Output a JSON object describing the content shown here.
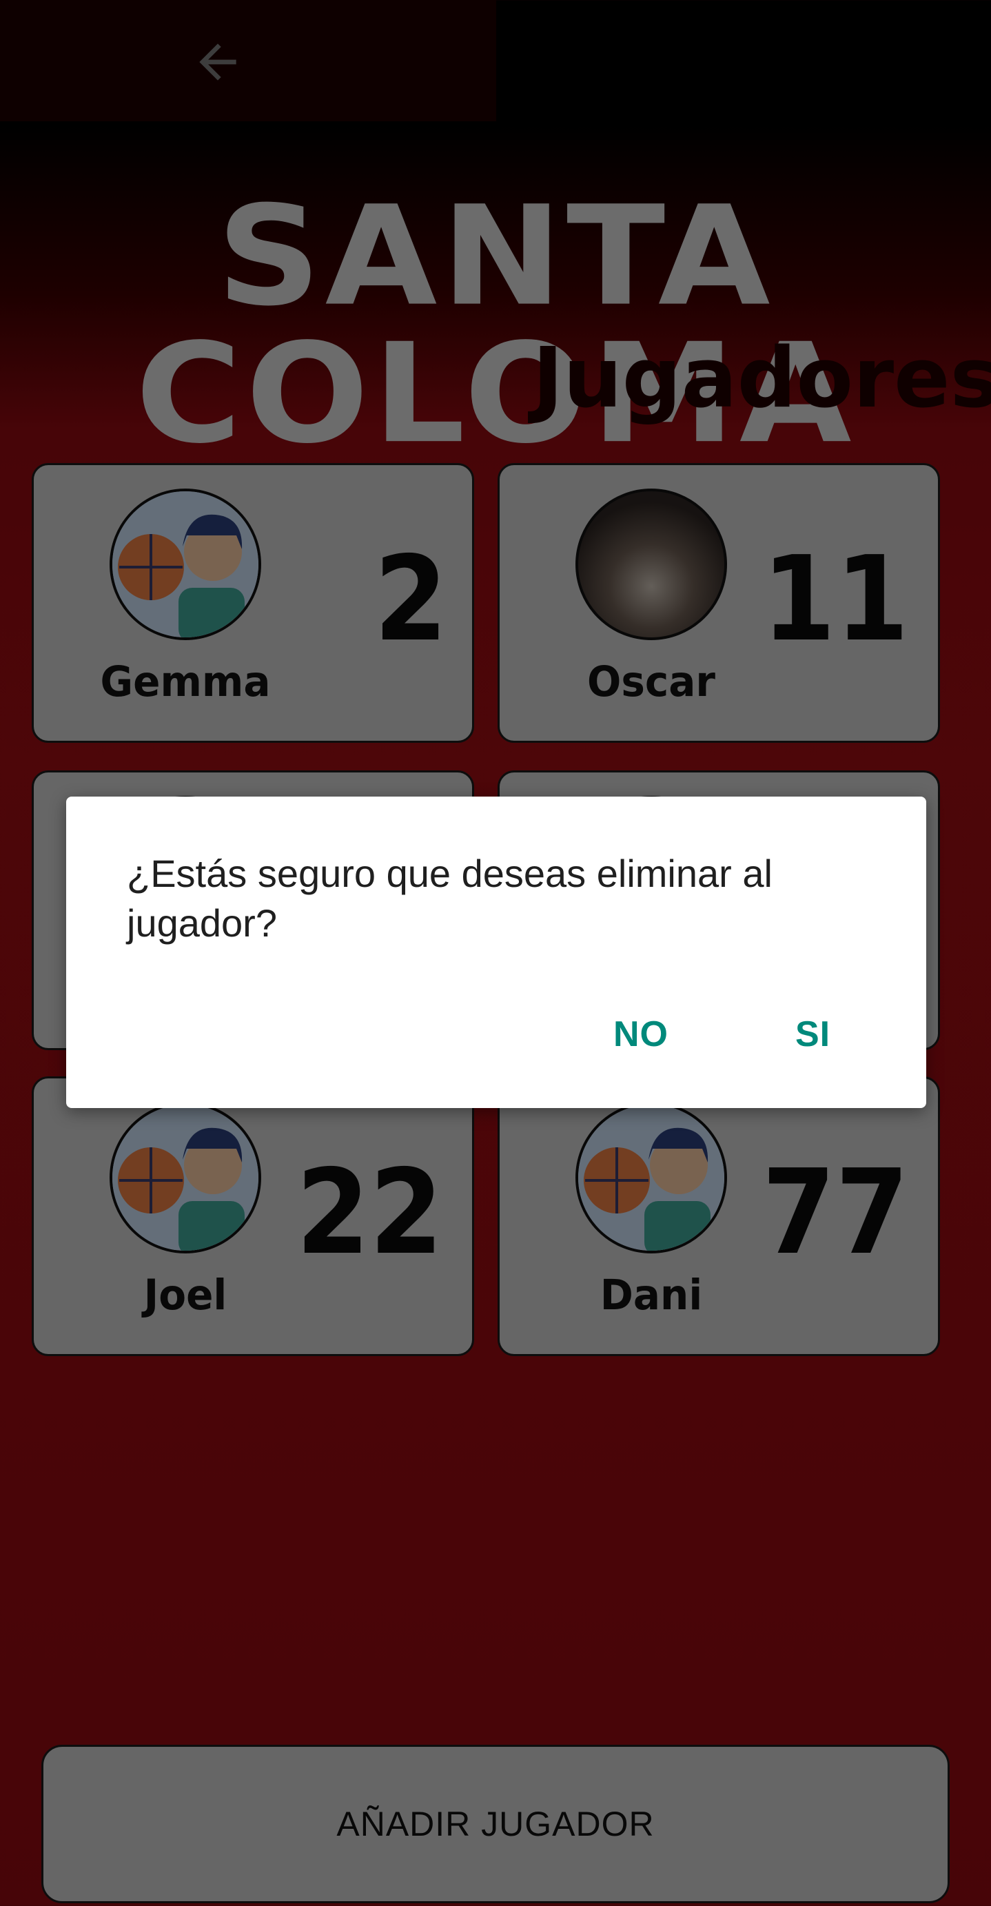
{
  "header": {
    "back_icon": "arrow-left-icon"
  },
  "team_name": "SANTA COLOMA",
  "section_title": "Jugadores",
  "players": [
    {
      "name": "Gemma",
      "number": "2",
      "avatar": "basketball-player-avatar"
    },
    {
      "name": "Oscar",
      "number": "11",
      "avatar": "photo-avatar"
    },
    {
      "name": "",
      "number": "",
      "avatar": "basketball-player-avatar"
    },
    {
      "name": "",
      "number": "",
      "avatar": "basketball-player-avatar"
    },
    {
      "name": "Joel",
      "number": "22",
      "avatar": "basketball-player-avatar"
    },
    {
      "name": "Dani",
      "number": "77",
      "avatar": "basketball-player-avatar"
    }
  ],
  "add_button_label": "AÑADIR JUGADOR",
  "dialog": {
    "message": "¿Estás seguro que deseas eliminar al jugador?",
    "no_label": "NO",
    "yes_label": "SI"
  },
  "colors": {
    "accent": "#00897b",
    "background_red": "#9a0c12",
    "card": "#cccccc"
  }
}
